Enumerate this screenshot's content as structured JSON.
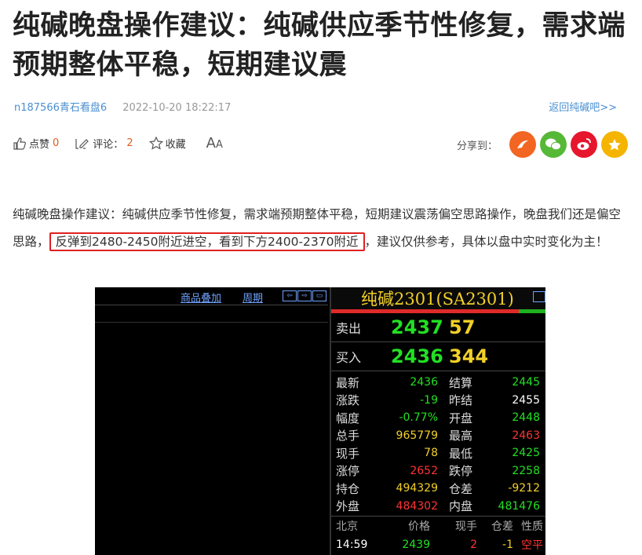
{
  "article": {
    "title": "纯碱晚盘操作建议：纯碱供应季节性修复，需求端预期整体平稳，短期建议震",
    "author": "n187566青石看盘6",
    "datetime": "2022-10-20 18:22:17",
    "back_link": "返回纯碱吧>>"
  },
  "actions": {
    "like_label": "点赞",
    "like_count": "0",
    "comment_label": "评论：",
    "comment_count": "2",
    "collect_label": "收藏",
    "font_label": "A",
    "font_label_small": "A",
    "share_label": "分享到："
  },
  "body": {
    "text_before": "纯碱晚盘操作建议：纯碱供应季节性修复，需求端预期整体平稳，短期建议震荡偏空思路操作，晚盘我们还是偏空思路，",
    "highlight": "反弹到2480-2450附近进空，看到下方2400-2370附近",
    "text_after": "，建议仅供参考，具体以盘中实时变化为主！"
  },
  "quote": {
    "links": [
      "商品叠加",
      "周期"
    ],
    "contract": "纯碱2301(SA2301)",
    "sell": {
      "label": "卖出",
      "price": "2437",
      "volume": "57"
    },
    "buy": {
      "label": "买入",
      "price": "2436",
      "volume": "344"
    },
    "rows": [
      {
        "k1": "最新",
        "v1": "2436",
        "c1": "g",
        "k2": "结算",
        "v2": "2445",
        "c2": "g"
      },
      {
        "k1": "涨跌",
        "v1": "-19",
        "c1": "g",
        "k2": "昨结",
        "v2": "2455",
        "c2": "w"
      },
      {
        "k1": "幅度",
        "v1": "-0.77%",
        "c1": "g",
        "k2": "开盘",
        "v2": "2448",
        "c2": "g"
      },
      {
        "k1": "总手",
        "v1": "965779",
        "c1": "y",
        "k2": "最高",
        "v2": "2463",
        "c2": "r"
      },
      {
        "k1": "现手",
        "v1": "78",
        "c1": "y",
        "k2": "最低",
        "v2": "2425",
        "c2": "g"
      },
      {
        "k1": "涨停",
        "v1": "2652",
        "c1": "r",
        "k2": "跌停",
        "v2": "2258",
        "c2": "g"
      },
      {
        "k1": "持仓",
        "v1": "494329",
        "c1": "y",
        "k2": "仓差",
        "v2": "-9212",
        "c2": "y"
      },
      {
        "k1": "外盘",
        "v1": "484302",
        "c1": "r",
        "k2": "内盘",
        "v2": "481476",
        "c2": "g"
      }
    ],
    "table_header": [
      "北京",
      "价格",
      "现手",
      "仓差",
      "性质"
    ],
    "tick": {
      "time": "14:59",
      "price": "2439",
      "qty": "2",
      "diff": "-1",
      "nature": "空平"
    }
  },
  "colors": {
    "accent": "#4a8fd1",
    "highlight_border": "#e02020"
  }
}
